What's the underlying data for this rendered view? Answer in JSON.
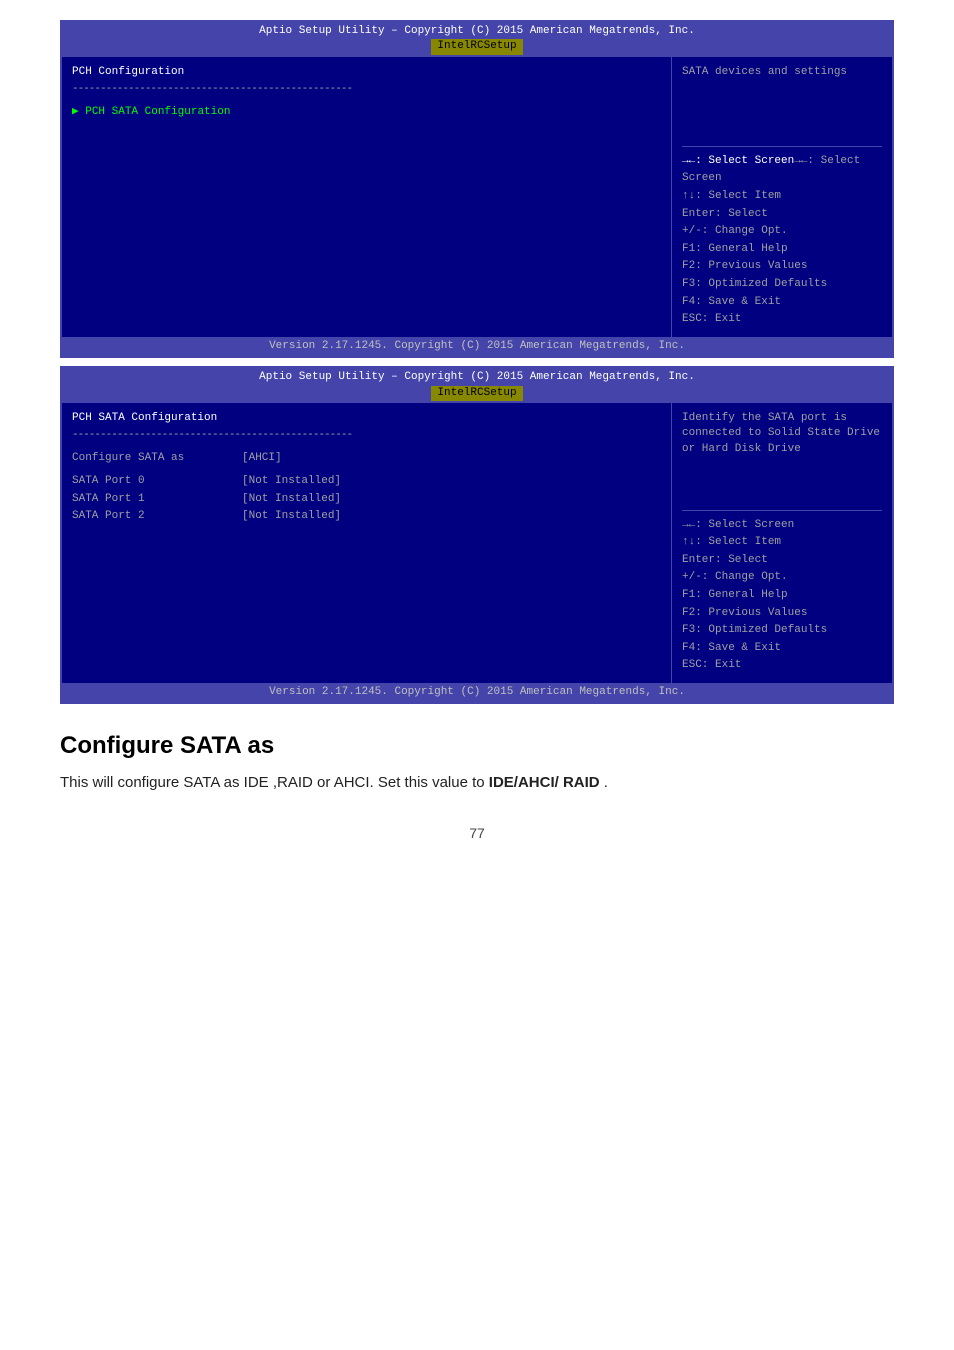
{
  "screen1": {
    "title_bar": "Aptio Setup Utility – Copyright (C) 2015 American Megatrends, Inc.",
    "tab_label": "IntelRCSetup",
    "left": {
      "section_title": "PCH Configuration",
      "divider": "--------------------------------------------------",
      "menu_item": "▶ PCH SATA Configuration"
    },
    "right": {
      "description": "SATA devices and settings",
      "help_lines": [
        "→←: Select Screen",
        "↑↓: Select Item",
        "Enter: Select",
        "+/-: Change Opt.",
        "F1: General Help",
        "F2: Previous Values",
        "F3: Optimized Defaults",
        "F4: Save & Exit",
        "ESC: Exit"
      ]
    },
    "footer": "Version 2.17.1245. Copyright (C) 2015 American Megatrends, Inc."
  },
  "screen2": {
    "title_bar": "Aptio Setup Utility – Copyright (C) 2015 American Megatrends, Inc.",
    "tab_label": "IntelRCSetup",
    "left": {
      "section_title": "PCH SATA Configuration",
      "divider": "--------------------------------------------------",
      "config_rows": [
        {
          "label": "Configure SATA as",
          "value": "[AHCI]"
        },
        {
          "label": "",
          "value": ""
        },
        {
          "label": "SATA Port 0",
          "value": "[Not Installed]"
        },
        {
          "label": "SATA Port 1",
          "value": "[Not Installed]"
        },
        {
          "label": "SATA Port 2",
          "value": "[Not Installed]"
        }
      ]
    },
    "right": {
      "description": "Identify the SATA port is connected to Solid State Drive or Hard Disk Drive",
      "help_lines": [
        "→←: Select Screen",
        "↑↓: Select Item",
        "Enter: Select",
        "+/-: Change Opt.",
        "F1: General Help",
        "F2: Previous Values",
        "F3: Optimized Defaults",
        "F4: Save & Exit",
        "ESC: Exit"
      ]
    },
    "footer": "Version 2.17.1245. Copyright (C) 2015 American Megatrends, Inc."
  },
  "text_section": {
    "heading": "Configure SATA as",
    "body_normal": "This will configure SATA as IDE ,RAID or AHCI. Set this value to ",
    "body_bold": "IDE/AHCI/ RAID",
    "body_end": " ."
  },
  "page_number": "77"
}
